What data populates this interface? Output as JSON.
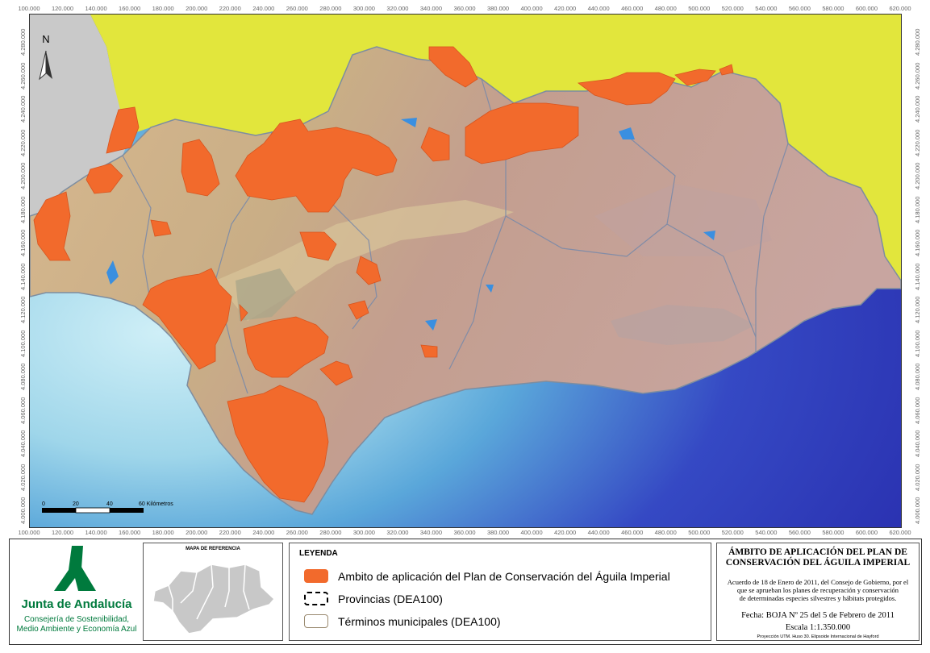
{
  "map": {
    "x_ticks": [
      "100.000",
      "120.000",
      "140.000",
      "160.000",
      "180.000",
      "200.000",
      "220.000",
      "240.000",
      "260.000",
      "280.000",
      "300.000",
      "320.000",
      "340.000",
      "360.000",
      "380.000",
      "400.000",
      "420.000",
      "440.000",
      "460.000",
      "480.000",
      "500.000",
      "520.000",
      "540.000",
      "560.000",
      "580.000",
      "600.000",
      "620.000"
    ],
    "y_ticks": [
      "4.280.000",
      "4.260.000",
      "4.240.000",
      "4.220.000",
      "4.200.000",
      "4.180.000",
      "4.160.000",
      "4.140.000",
      "4.120.000",
      "4.100.000",
      "4.080.000",
      "4.060.000",
      "4.040.000",
      "4.020.000",
      "4.000.000"
    ],
    "north_label": "N",
    "scale_bar": {
      "labels": [
        "0",
        "20",
        "40",
        "60 Kilómetros"
      ]
    },
    "colors": {
      "sea_light": "#bfe4f2",
      "sea_deep": "#2a32b8",
      "outside_land": "#e2e63c",
      "portugal": "#c9c9c9",
      "terrain": "#c8a887",
      "plan_area": "#f26a2c"
    }
  },
  "reference_map": {
    "title": "MAPA DE REFERENCIA"
  },
  "legend": {
    "title": "LEYENDA",
    "items": [
      {
        "label": "Ambito de aplicación del Plan de Conservación del Águila Imperial",
        "color": "#f26a2c"
      },
      {
        "label": "Provincias (DEA100)",
        "color": "#ffffff"
      },
      {
        "label": "Términos municipales (DEA100)",
        "color": "#ffffff"
      }
    ]
  },
  "logo": {
    "org_name": "Junta de Andalucía",
    "dept_line1": "Consejería de Sostenibilidad,",
    "dept_line2": "Medio Ambiente y Economía Azul",
    "color": "#007a3d"
  },
  "info": {
    "title_line1": "ÁMBITO DE APLICACIÓN DEL PLAN DE",
    "title_line2": "CONSERVACIÓN DEL ÁGUILA IMPERIAL",
    "desc_line1": "Acuerdo de 18 de Enero de 2011, del Consejo de Gobierno, por el",
    "desc_line2": "que se aprueban los planes de recuperación y conservación",
    "desc_line3": "de determinadas especies silvestres y hábitats protegidos.",
    "date_line": "Fecha:  BOJA Nº 25 del 5 de Febrero de 2011",
    "scale_line": "Escala    1:1.350.000",
    "projection": "Proyección UTM. Huso 30. Elipsoide Internacional de Hayford"
  }
}
